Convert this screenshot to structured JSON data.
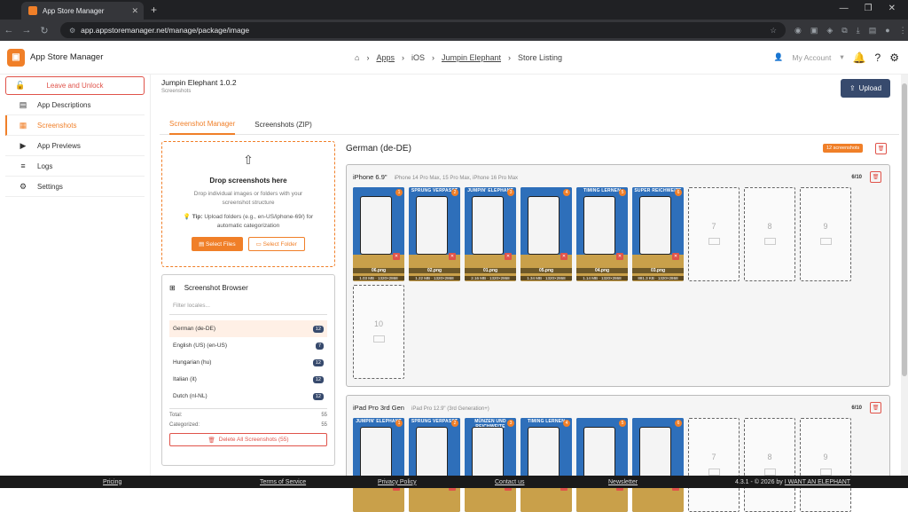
{
  "browser": {
    "tab_title": "App Store Manager",
    "url": "app.appstoremanager.net/manage/package/image"
  },
  "header": {
    "app_name": "App Store Manager",
    "breadcrumb": [
      "Apps",
      "iOS",
      "Jumpin Elephant",
      "Store Listing"
    ],
    "account_label": "My Account"
  },
  "sidebar": {
    "leave_label": "Leave and Unlock",
    "items": [
      {
        "label": "App Descriptions",
        "icon": "document-icon"
      },
      {
        "label": "Screenshots",
        "icon": "images-icon"
      },
      {
        "label": "App Previews",
        "icon": "video-icon"
      },
      {
        "label": "Logs",
        "icon": "list-icon"
      },
      {
        "label": "Settings",
        "icon": "gear-icon"
      }
    ]
  },
  "package": {
    "title": "Jumpin Elephant 1.0.2",
    "subtitle": "Screenshots",
    "upload_label": "Upload"
  },
  "tabs": [
    "Screenshot Manager",
    "Screenshots (ZIP)"
  ],
  "dropzone": {
    "title": "Drop screenshots here",
    "desc": "Drop individual images or folders with your screenshot structure",
    "tip_label": "Tip:",
    "tip": "Upload folders (e.g., en-US/iphone-69/) for automatic categorization",
    "select_files": "Select Files",
    "select_folder": "Select Folder"
  },
  "screenshot_browser": {
    "title": "Screenshot Browser",
    "filter_placeholder": "Filter locales...",
    "locales": [
      {
        "name": "German (de-DE)",
        "count": "12"
      },
      {
        "name": "English (US) (en-US)",
        "count": "7"
      },
      {
        "name": "Hungarian (hu)",
        "count": "12"
      },
      {
        "name": "Italian (it)",
        "count": "12"
      },
      {
        "name": "Dutch (nl-NL)",
        "count": "12"
      }
    ],
    "total_label": "Total:",
    "total": "55",
    "categorized_label": "Categorized:",
    "categorized": "55",
    "delete_all": "Delete All Screenshots (55)"
  },
  "locale_panel": {
    "title": "German (de-DE)",
    "badge": "12 screenshots"
  },
  "devices": [
    {
      "name": "iPhone 6.9\"",
      "models": "iPhone 14 Pro Max, 15 Pro Max, iPhone 16 Pro Max",
      "count": "6/10",
      "shots": [
        {
          "n": "1",
          "caption": "",
          "file": "06.png",
          "meta": "1.03 MB · 1320×2868"
        },
        {
          "n": "2",
          "caption": "SPRUNG VERPASST",
          "file": "02.png",
          "meta": "1.22 MB · 1320×2868"
        },
        {
          "n": "3",
          "caption": "JUMPIN' ELEPHANT",
          "file": "01.png",
          "meta": "2.16 MB · 1320×2868"
        },
        {
          "n": "4",
          "caption": "",
          "file": "05.png",
          "meta": "1.34 MB · 1320×2868"
        },
        {
          "n": "5",
          "caption": "TIMING LERNEN",
          "file": "04.png",
          "meta": "1.14 MB · 1320×2868"
        },
        {
          "n": "6",
          "caption": "SUPER REICHWEITE",
          "file": "03.png",
          "meta": "881.3 KB · 1320×2868"
        }
      ],
      "empty": [
        "7",
        "8",
        "9",
        "10"
      ]
    },
    {
      "name": "iPad Pro 3rd Gen",
      "models": "iPad Pro 12.9\" (3rd Generation+)",
      "count": "6/10",
      "shots": [
        {
          "n": "1",
          "caption": "JUMPIN' ELEPHANT",
          "file": "",
          "meta": ""
        },
        {
          "n": "2",
          "caption": "SPRUNG VERPASST",
          "file": "",
          "meta": ""
        },
        {
          "n": "3",
          "caption": "MÜNZEN UND REICHWEITE",
          "file": "",
          "meta": ""
        },
        {
          "n": "4",
          "caption": "TIMING LERNEN",
          "file": "",
          "meta": ""
        },
        {
          "n": "5",
          "caption": "",
          "file": "",
          "meta": ""
        },
        {
          "n": "6",
          "caption": "",
          "file": "",
          "meta": ""
        }
      ],
      "empty": [
        "7",
        "8",
        "9"
      ]
    }
  ],
  "footer": {
    "links": [
      "Pricing",
      "Terms of Service",
      "Privacy Policy",
      "Contact us",
      "Newsletter"
    ],
    "version": "4.3.1 - © 2026 by",
    "company": "I WANT AN ELEPHANT"
  },
  "colors": {
    "accent": "#f07f28",
    "primary": "#374a6d",
    "danger": "#e0534a"
  }
}
